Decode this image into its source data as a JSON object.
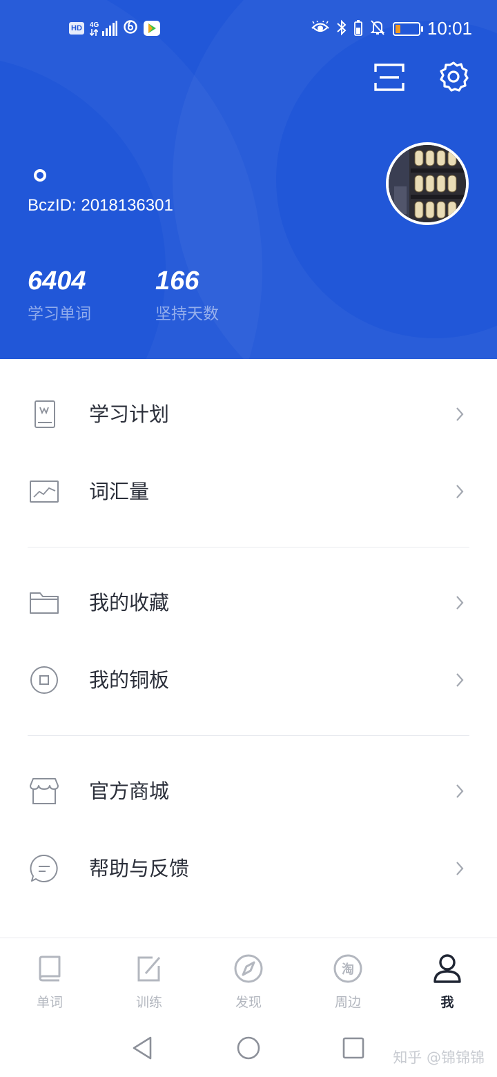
{
  "status_bar": {
    "hd": "HD",
    "network": "4G",
    "time": "10:01",
    "battery_color": "#f39a1e"
  },
  "header": {
    "bg_color": "#2157d8",
    "bcz_id": "BczID: 2018136301",
    "stats": [
      {
        "value": "6404",
        "label": "学习单词"
      },
      {
        "value": "166",
        "label": "坚持天数"
      }
    ],
    "actions": [
      "scan-icon",
      "settings-icon"
    ]
  },
  "menu": {
    "items": [
      {
        "label": "学习计划",
        "icon": "study-plan-icon"
      },
      {
        "label": "词汇量",
        "icon": "vocabulary-chart-icon"
      },
      {
        "label": "我的收藏",
        "icon": "folder-icon"
      },
      {
        "label": "我的铜板",
        "icon": "coin-icon"
      },
      {
        "label": "官方商城",
        "icon": "store-icon"
      },
      {
        "label": "帮助与反馈",
        "icon": "chat-bubble-icon"
      }
    ]
  },
  "tabbar": {
    "tabs": [
      {
        "label": "单词",
        "icon": "book-icon",
        "active": false
      },
      {
        "label": "训练",
        "icon": "edit-icon",
        "active": false
      },
      {
        "label": "发现",
        "icon": "compass-icon",
        "active": false
      },
      {
        "label": "周边",
        "icon": "taobao-icon",
        "glyph": "淘",
        "active": false
      },
      {
        "label": "我",
        "icon": "person-icon",
        "active": true
      }
    ]
  },
  "watermark": "知乎 @锦锦锦"
}
